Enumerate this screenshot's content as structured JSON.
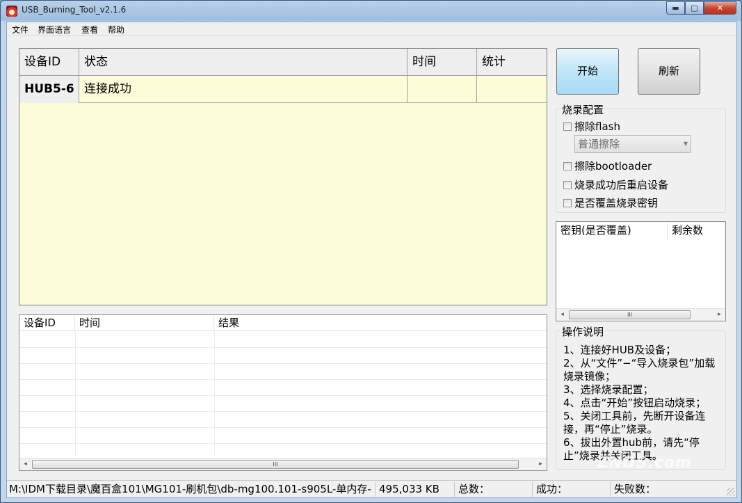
{
  "window": {
    "title": "USB_Burning_Tool_v2.1.6",
    "minimize_glyph": "▬",
    "maximize_glyph": "□",
    "close_glyph": "✕"
  },
  "menu": [
    "文件",
    "界面语言",
    "查看",
    "帮助"
  ],
  "device_grid": {
    "headers": [
      "设备ID",
      "状态",
      "时间",
      "统计"
    ],
    "rows": [
      [
        "HUB5-6",
        "连接成功",
        "",
        ""
      ]
    ]
  },
  "log_list": {
    "headers": [
      "设备ID",
      "时间",
      "结果"
    ],
    "scroll_thumb": "III"
  },
  "buttons": {
    "start": "开始",
    "refresh": "刷新"
  },
  "burn_config": {
    "title": "烧录配置",
    "erase_flash": {
      "label": "擦除flash",
      "checked": false
    },
    "erase_mode": "普通擦除",
    "erase_bootloader": {
      "label": "擦除bootloader",
      "checked": false
    },
    "reboot_after": {
      "label": "烧录成功后重启设备",
      "checked": false
    },
    "overwrite_key": {
      "label": "是否覆盖烧录密钥",
      "checked": false
    }
  },
  "key_list": {
    "headers": [
      "密钥(是否覆盖)",
      "剩余数"
    ],
    "scroll_thumb": "III"
  },
  "instructions": {
    "title": "操作说明",
    "lines": [
      "1、连接好HUB及设备；",
      "2、从“文件”−“导入烧录包”加载烧录镜像；",
      "3、选择烧录配置；",
      "4、点击“开始”按钮启动烧录；",
      "5、关闭工具前，先断开设备连接，再“停止”烧录。",
      "6、拔出外置hub前，请先“停止”烧录并关闭工具。"
    ]
  },
  "status_bar": {
    "path": "M:\\IDM下载目录\\魔百盒101\\MG101-刷机包\\db-mg100.101-s905L-单内存-",
    "size": "495,033 KB",
    "total": "总数：",
    "success": "成功：",
    "fail": "失败数："
  },
  "watermark": "ZNDS.com"
}
